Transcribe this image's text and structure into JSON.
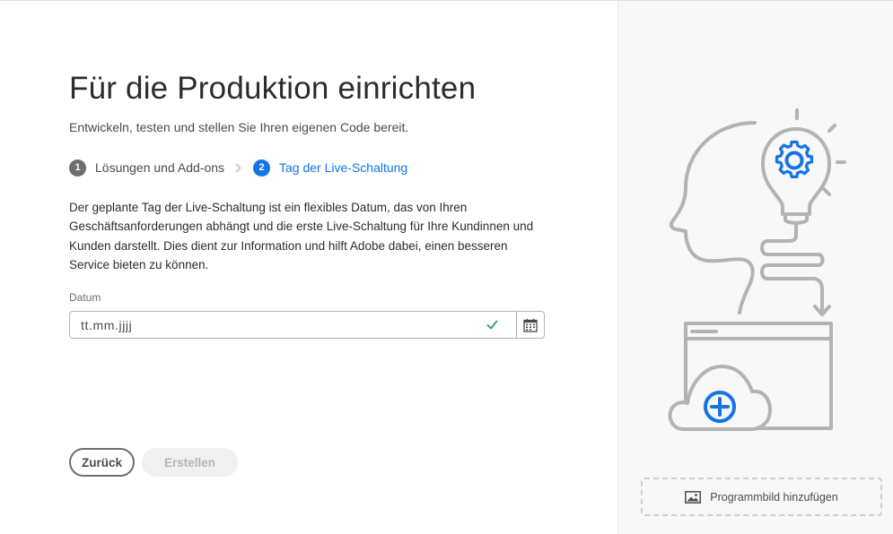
{
  "page": {
    "title": "Für die Produktion einrichten",
    "subtitle": "Entwickeln, testen und stellen Sie Ihren eigenen Code bereit."
  },
  "steps": [
    {
      "number": "1",
      "label": "Lösungen und Add-ons",
      "state": "completed"
    },
    {
      "number": "2",
      "label": "Tag der Live-Schaltung",
      "state": "active"
    }
  ],
  "description": "Der geplante Tag der Live-Schaltung ist ein flexibles Datum, das von Ihren Geschäftsanforderungen abhängt und die erste Live-Schaltung für Ihre Kundinnen und Kunden darstellt. Dies dient zur Information und hilft Adobe dabei, einen besseren Service bieten zu können.",
  "date_field": {
    "label": "Datum",
    "placeholder": "tt.mm.jjjj",
    "value": "",
    "valid": true
  },
  "buttons": {
    "back": "Zurück",
    "create": "Erstellen"
  },
  "sidebar": {
    "add_image_label": "Programmbild hinzufügen"
  },
  "colors": {
    "accent": "#1473e6",
    "success": "#2d9d78",
    "illustration_stroke": "#b3b3b3"
  },
  "icons": {
    "step_separator": "chevron-right-icon",
    "valid": "checkmark-icon",
    "calendar": "calendar-icon",
    "add_image": "image-icon"
  }
}
